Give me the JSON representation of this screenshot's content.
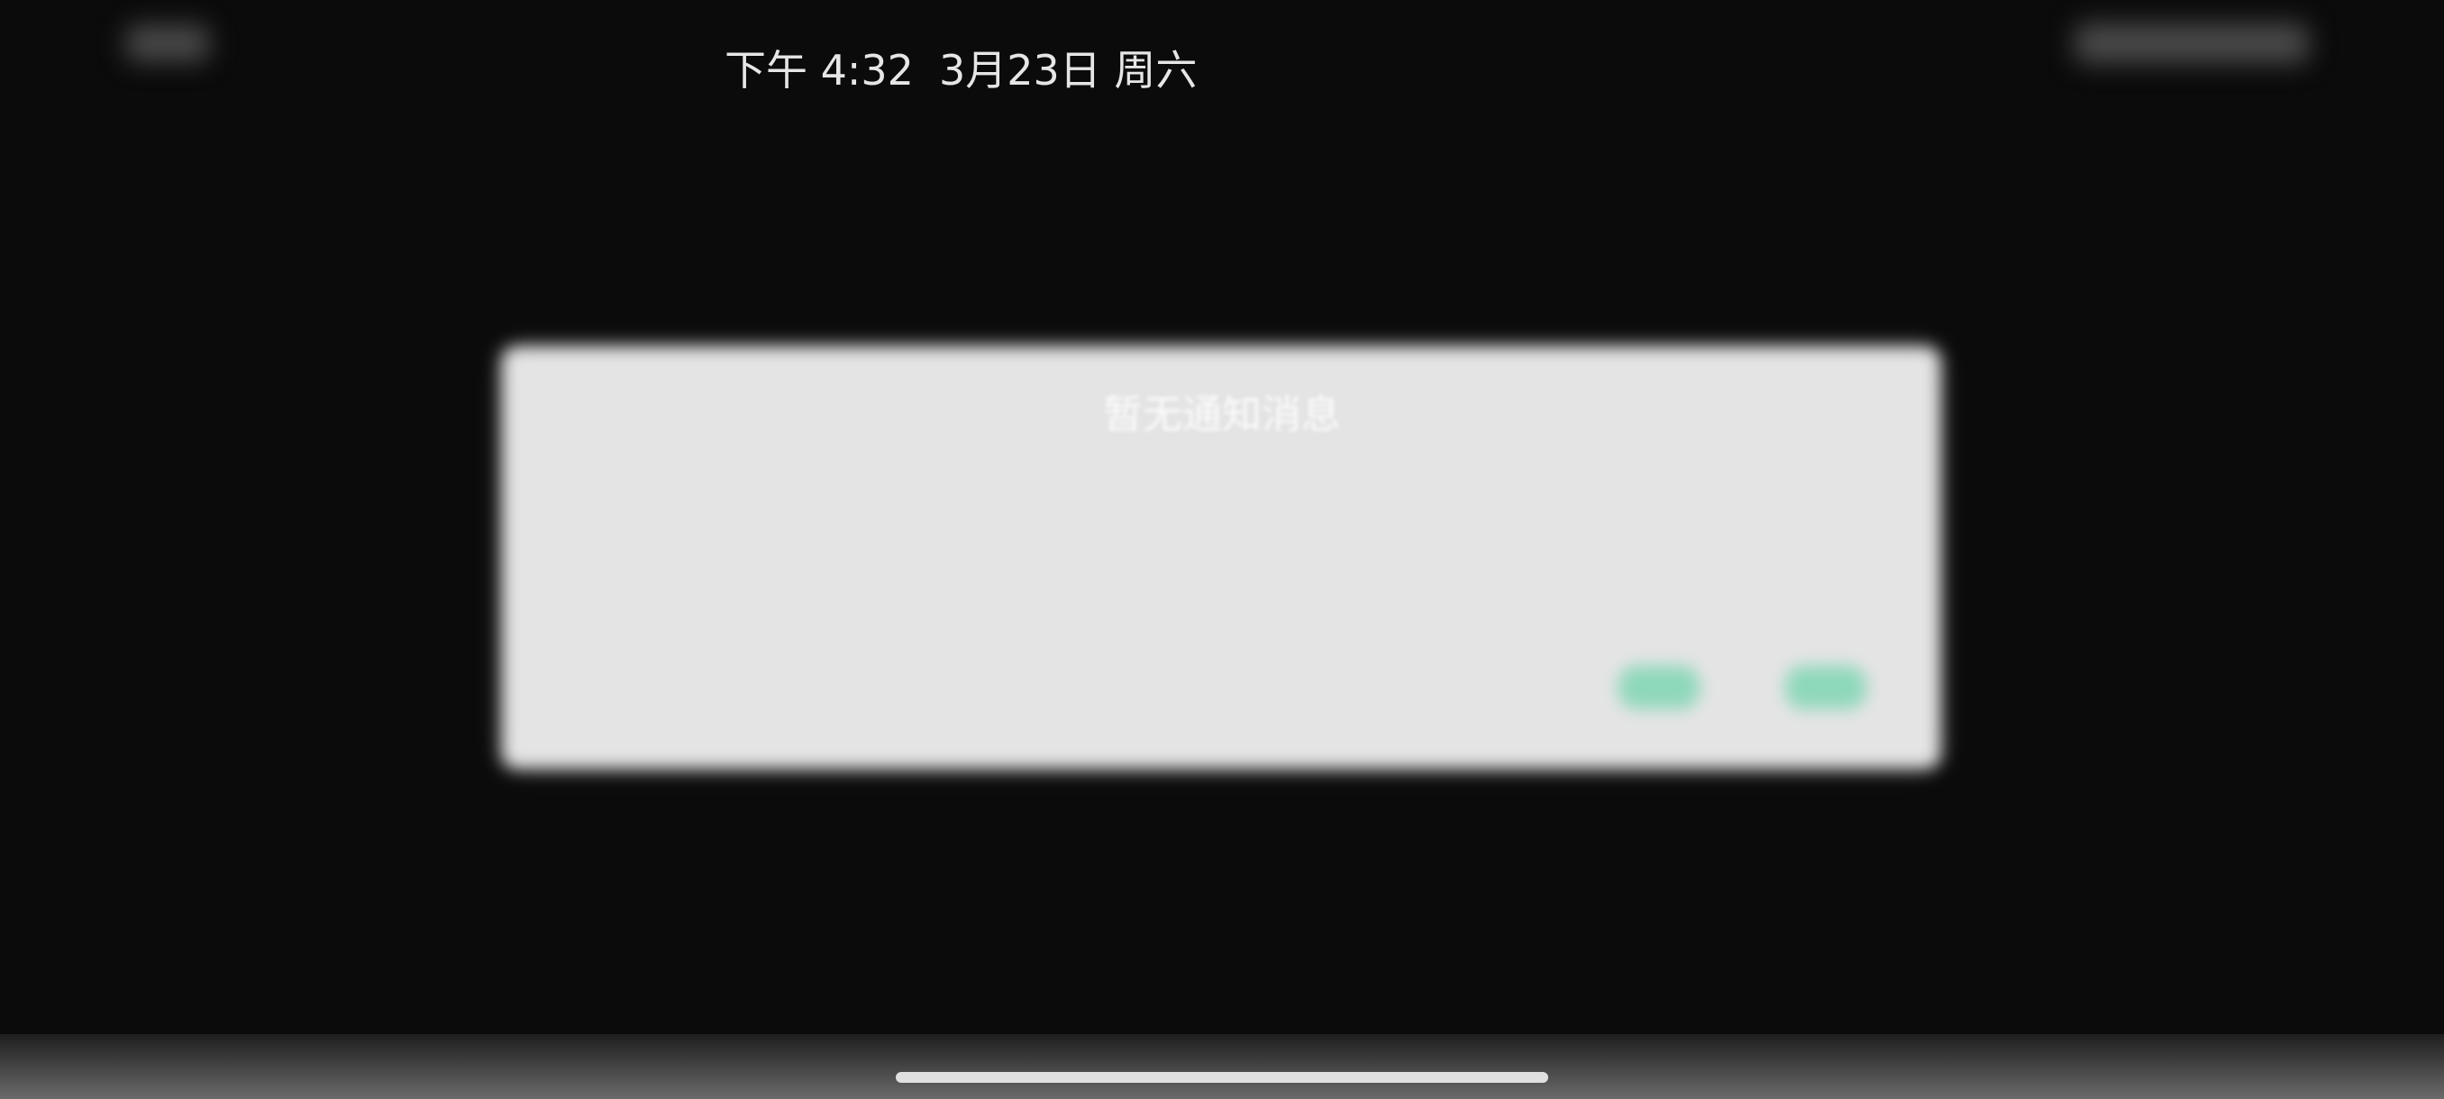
{
  "status_bar": {
    "period": "下午",
    "time": "4:32",
    "date": "3月23日",
    "weekday": "周六"
  },
  "notifications": {
    "empty_text": "暂无通知消息"
  },
  "dialog": {
    "title": "",
    "message": "",
    "cancel_label": "",
    "confirm_label": "",
    "button_color": "#7fd6b4"
  }
}
